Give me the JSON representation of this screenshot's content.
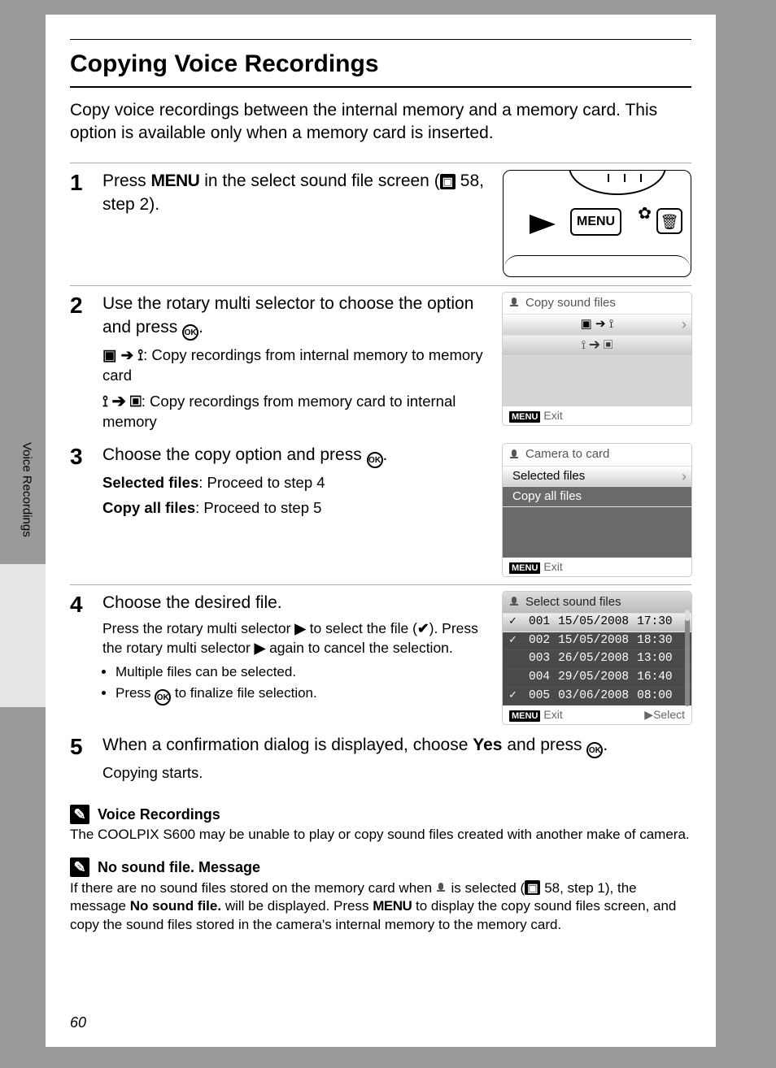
{
  "sidebar": {
    "label": "Voice Recordings"
  },
  "title": "Copying Voice Recordings",
  "intro": "Copy voice recordings between the internal memory and a memory card. This option is available only when a memory card is inserted.",
  "steps": {
    "s1": {
      "num": "1",
      "text_a": "Press ",
      "menu": "MENU",
      "text_b": " in the select sound file screen (",
      "ref": "58, step 2",
      "text_c": ").",
      "diagram_menu": "MENU"
    },
    "s2": {
      "num": "2",
      "title_a": "Use the rotary multi selector to choose the option and press ",
      "ok": "OK",
      "title_b": ".",
      "opt1": ": Copy recordings from internal memory to memory card",
      "opt2": ": Copy recordings from memory card to internal memory",
      "lcd_title": "Copy sound files",
      "lcd_exit": "Exit"
    },
    "s3": {
      "num": "3",
      "title_a": "Choose the copy option and press ",
      "ok": "OK",
      "title_b": ".",
      "line1a": "Selected files",
      "line1b": ": Proceed to step 4",
      "line2a": "Copy all files",
      "line2b": ": Proceed to step 5",
      "lcd_title": "Camera to card",
      "lcd_row1": "Selected files",
      "lcd_row2": "Copy all files",
      "lcd_exit": "Exit"
    },
    "s4": {
      "num": "4",
      "title": "Choose the desired file.",
      "p1a": "Press the rotary multi selector ",
      "p1b": " to select the file (",
      "p1c": "). Press the rotary multi selector ",
      "p1d": " again to cancel the selection.",
      "b1": "Multiple files can be selected.",
      "b2a": "Press ",
      "b2b": " to finalize file selection.",
      "lcd_title": "Select sound files",
      "rows": [
        {
          "chk": "✓",
          "id": "001",
          "date": "15/05/2008",
          "time": "17:30"
        },
        {
          "chk": "✓",
          "id": "002",
          "date": "15/05/2008",
          "time": "18:30"
        },
        {
          "chk": "",
          "id": "003",
          "date": "26/05/2008",
          "time": "13:00"
        },
        {
          "chk": "",
          "id": "004",
          "date": "29/05/2008",
          "time": "16:40"
        },
        {
          "chk": "✓",
          "id": "005",
          "date": "03/06/2008",
          "time": "08:00"
        }
      ],
      "lcd_exit": "Exit",
      "lcd_select": "Select"
    },
    "s5": {
      "num": "5",
      "title_a": "When a confirmation dialog is displayed, choose ",
      "yes": "Yes",
      "title_b": " and press ",
      "ok": "OK",
      "title_c": ".",
      "sub": "Copying starts."
    }
  },
  "notes": {
    "n1_title": "Voice Recordings",
    "n1_body": "The COOLPIX S600 may be unable to play or copy sound files created with another make of camera.",
    "n2_title": "No sound file. Message",
    "n2_a": "If there are no sound files stored on the memory card when ",
    "n2_b": " is selected (",
    "n2_ref": "58, step 1",
    "n2_c": "), the message ",
    "n2_bold": "No sound file.",
    "n2_d": " will be displayed. Press ",
    "n2_menu": "MENU",
    "n2_e": " to display the copy sound files screen, and copy the sound files stored in the camera's internal memory to the memory card."
  },
  "page_number": "60"
}
